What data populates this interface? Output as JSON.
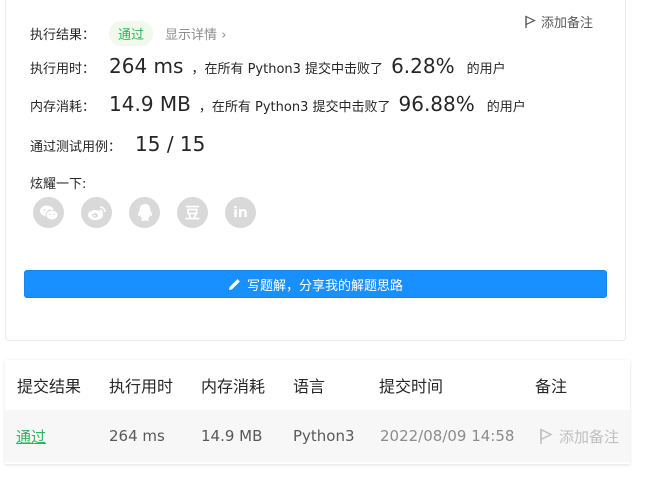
{
  "result": {
    "label": "执行结果：",
    "status": "通过",
    "detail_link": "显示详情",
    "detail_chevron": "›",
    "add_note": "添加备注"
  },
  "runtime": {
    "label": "执行用时：",
    "value": "264 ms",
    "beat_text": "，在所有 Python3 提交中击败了",
    "percent": "6.28%",
    "suffix": "的用户"
  },
  "memory": {
    "label": "内存消耗：",
    "value": "14.9 MB",
    "beat_text": "，在所有 Python3 提交中击败了",
    "percent": "96.88%",
    "suffix": "的用户"
  },
  "testcases": {
    "label": "通过测试用例：",
    "value": "15 / 15"
  },
  "share": {
    "label": "炫耀一下:",
    "icons": [
      "wechat-icon",
      "weibo-icon",
      "qq-icon",
      "douban-icon",
      "linkedin-icon"
    ],
    "douban_glyph": "豆",
    "linkedin_glyph": "in"
  },
  "write_solution": {
    "label": "写题解，分享我的解题思路",
    "color": "#1890ff"
  },
  "submissions": {
    "headers": [
      "提交结果",
      "执行用时",
      "内存消耗",
      "语言",
      "提交时间",
      "备注"
    ],
    "rows": [
      {
        "status": "通过",
        "runtime": "264 ms",
        "memory": "14.9 MB",
        "language": "Python3",
        "time": "2022/08/09 14:58",
        "note": "添加备注"
      }
    ]
  },
  "colors": {
    "pass_green": "#2db55d",
    "primary_blue": "#1890ff",
    "share_grey": "#d9d9d9"
  }
}
